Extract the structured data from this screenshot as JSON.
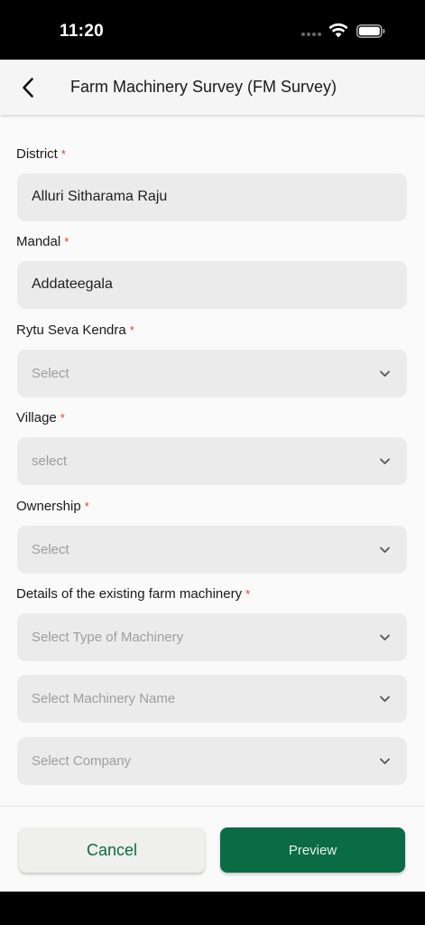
{
  "status_bar": {
    "time": "11:20",
    "icons": [
      "signal-dots-icon",
      "wifi-icon",
      "battery-icon"
    ]
  },
  "header": {
    "back_icon": "chevron-left-icon",
    "title": "Farm Machinery Survey (FM Survey)"
  },
  "form": {
    "district": {
      "label": "District",
      "required_mark": "*",
      "value": "Alluri Sitharama Raju"
    },
    "mandal": {
      "label": "Mandal",
      "required_mark": "*",
      "value": "Addateegala"
    },
    "rsk": {
      "label": "Rytu Seva Kendra",
      "required_mark": "*",
      "placeholder": "Select"
    },
    "village": {
      "label": "Village",
      "required_mark": "*",
      "placeholder": "select"
    },
    "ownership": {
      "label": "Ownership",
      "required_mark": "*",
      "placeholder": "Select"
    },
    "machinery": {
      "label": "Details of the existing farm machinery",
      "required_mark": "*",
      "type_placeholder": "Select Type of Machinery",
      "name_placeholder": "Select Machinery Name",
      "company_placeholder": "Select Company"
    }
  },
  "footer": {
    "cancel_label": "Cancel",
    "preview_label": "Preview"
  },
  "colors": {
    "accent_green": "#0b6b45",
    "required_red": "#e53935",
    "field_bg": "#ebebeb",
    "placeholder_gray": "#9e9e9e"
  }
}
